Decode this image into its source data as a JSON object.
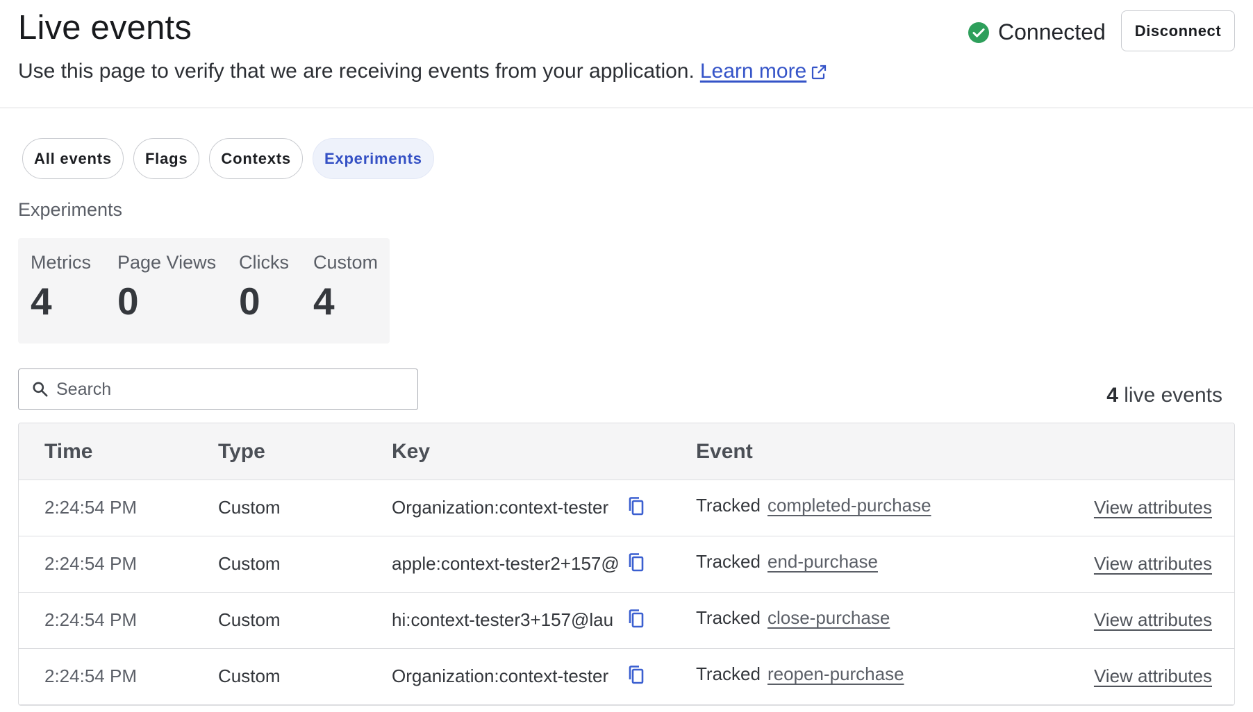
{
  "header": {
    "title": "Live events",
    "description": "Use this page to verify that we are receiving events from your application.",
    "learn_more": "Learn more",
    "status_label": "Connected",
    "disconnect_label": "Disconnect"
  },
  "tabs": [
    {
      "label": "All events",
      "active": false
    },
    {
      "label": "Flags",
      "active": false
    },
    {
      "label": "Contexts",
      "active": false
    },
    {
      "label": "Experiments",
      "active": true
    }
  ],
  "section_label": "Experiments",
  "stats": [
    {
      "label": "Metrics",
      "value": "4"
    },
    {
      "label": "Page Views",
      "value": "0"
    },
    {
      "label": "Clicks",
      "value": "0"
    },
    {
      "label": "Custom",
      "value": "4"
    }
  ],
  "search": {
    "placeholder": "Search",
    "value": ""
  },
  "live_count": {
    "number": "4",
    "suffix": "live events"
  },
  "table": {
    "columns": [
      "Time",
      "Type",
      "Key",
      "Event"
    ],
    "rows": [
      {
        "time": "2:24:54 PM",
        "type": "Custom",
        "key": "Organization:context-tester",
        "event_prefix": "Tracked",
        "event_name": "completed-purchase",
        "action": "View attributes"
      },
      {
        "time": "2:24:54 PM",
        "type": "Custom",
        "key": "apple:context-tester2+157@",
        "event_prefix": "Tracked",
        "event_name": "end-purchase",
        "action": "View attributes"
      },
      {
        "time": "2:24:54 PM",
        "type": "Custom",
        "key": "hi:context-tester3+157@lau",
        "event_prefix": "Tracked",
        "event_name": "close-purchase",
        "action": "View attributes"
      },
      {
        "time": "2:24:54 PM",
        "type": "Custom",
        "key": "Organization:context-tester",
        "event_prefix": "Tracked",
        "event_name": "reopen-purchase",
        "action": "View attributes"
      }
    ]
  },
  "colors": {
    "accent": "#3450c4",
    "link": "#3554c8",
    "connected": "#2e9f5b",
    "copy_icon": "#3a5fd0"
  },
  "icons": {
    "status": "check-circle-icon",
    "external": "external-link-icon",
    "search": "search-icon",
    "copy": "copy-icon"
  }
}
